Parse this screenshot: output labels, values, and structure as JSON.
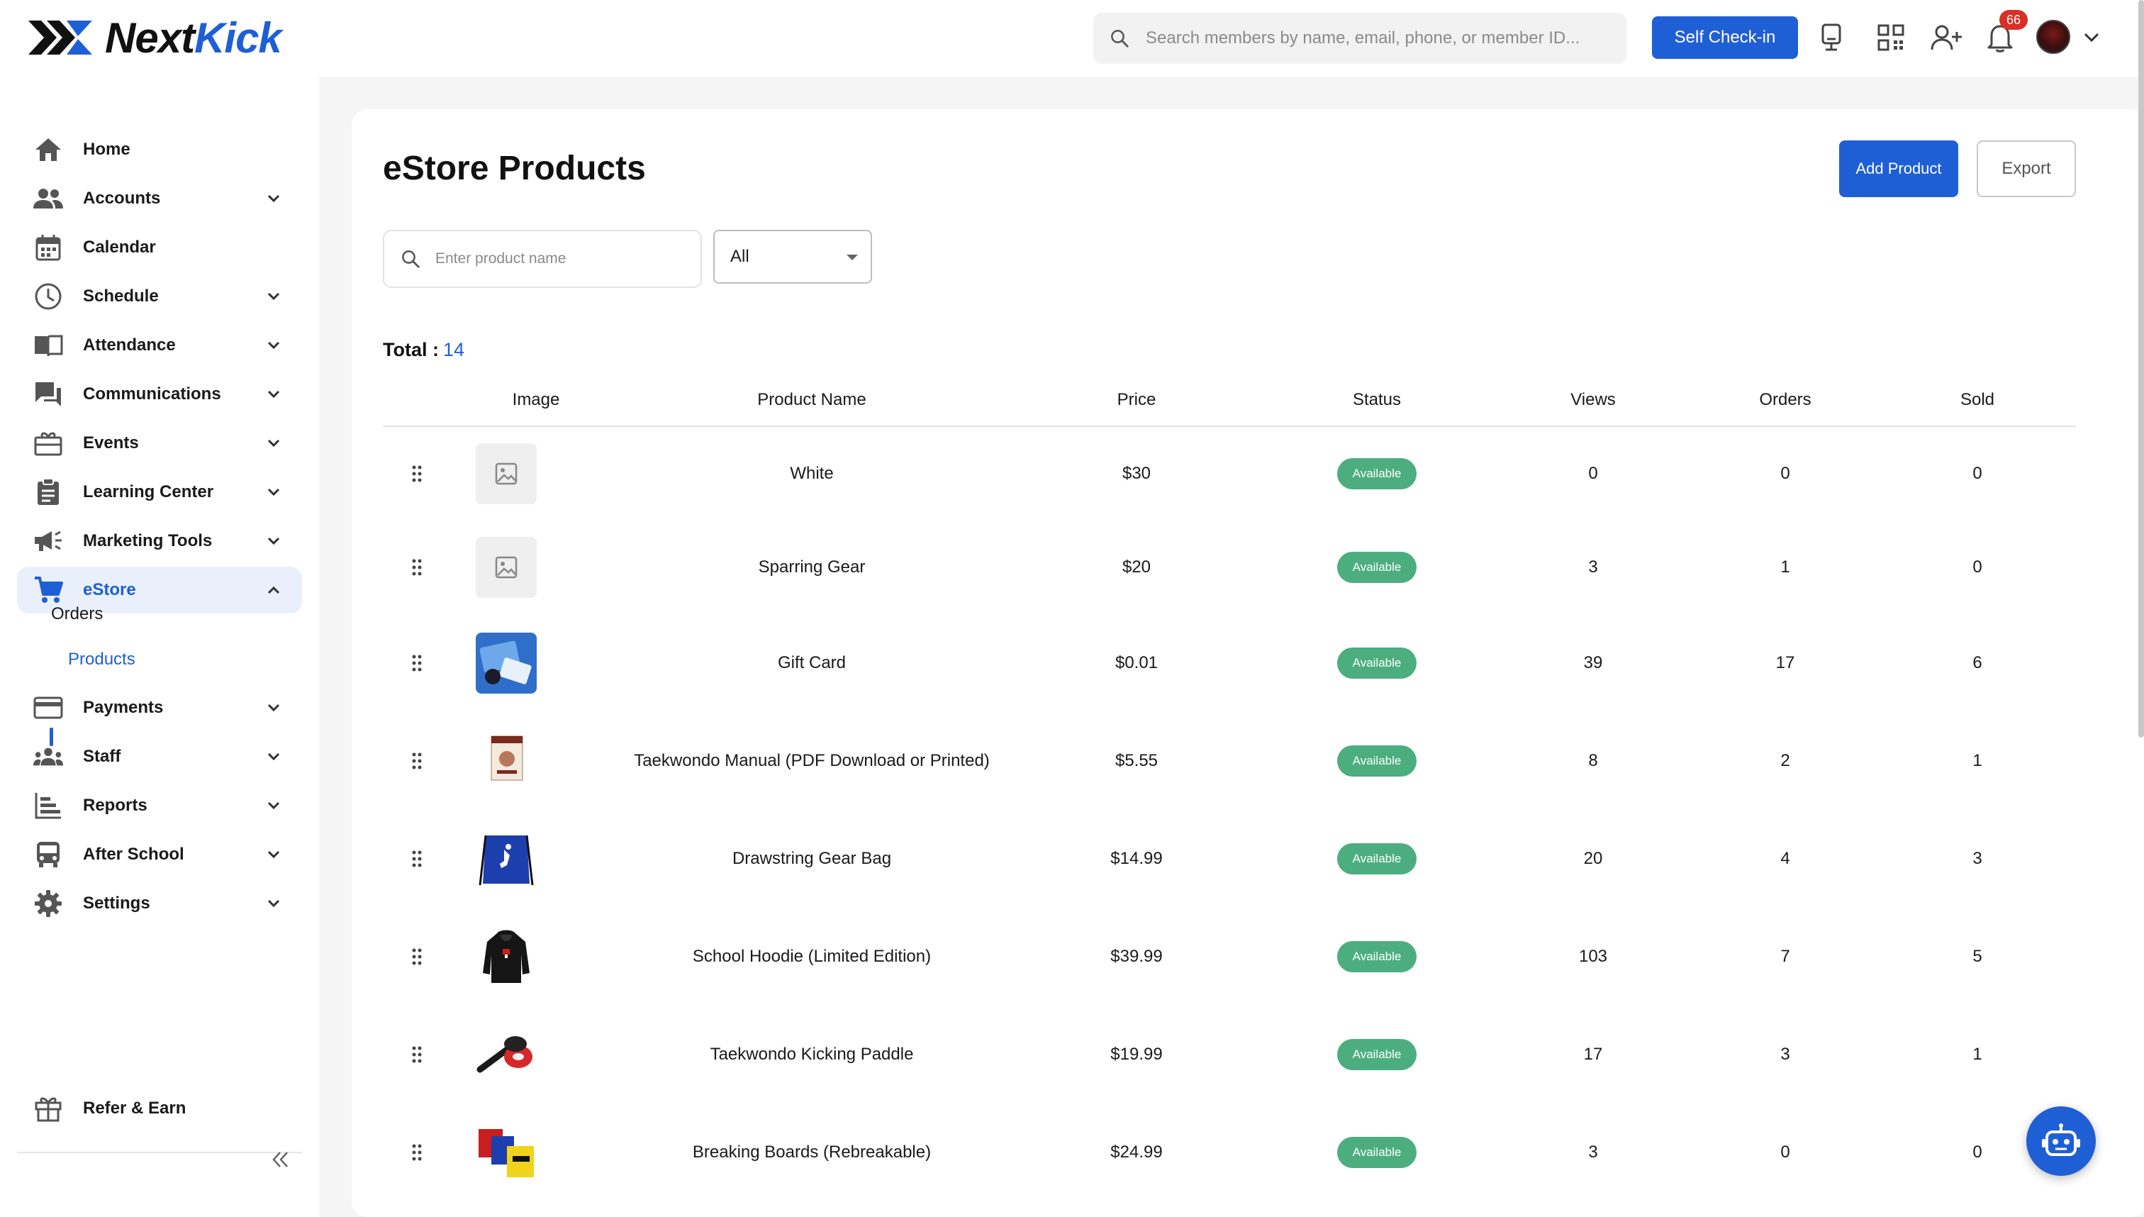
{
  "brand": {
    "name_part1": "Next",
    "name_part2": "Kick",
    "accent": "#1f5fd6"
  },
  "header": {
    "search_placeholder": "Search members by name, email, phone, or member ID...",
    "checkin_label": "Self Check-in",
    "notification_count": "66",
    "icons": [
      "kiosk-icon",
      "qr-code-icon",
      "add-person-icon",
      "bell-icon",
      "avatar",
      "chevron-down-icon"
    ]
  },
  "sidebar": {
    "items": [
      {
        "label": "Home",
        "icon": "home-icon"
      },
      {
        "label": "Accounts",
        "icon": "people-icon"
      },
      {
        "label": "Calendar",
        "icon": "calendar-icon"
      },
      {
        "label": "Schedule",
        "icon": "clock-icon"
      },
      {
        "label": "Attendance",
        "icon": "book-icon"
      },
      {
        "label": "Communications",
        "icon": "chat-icon"
      },
      {
        "label": "Events",
        "icon": "ticket-icon"
      },
      {
        "label": "Learning Center",
        "icon": "clipboard-icon"
      },
      {
        "label": "Marketing Tools",
        "icon": "megaphone-icon"
      },
      {
        "label": "eStore",
        "icon": "cart-icon"
      },
      {
        "label": "Payments",
        "icon": "card-icon"
      },
      {
        "label": "Staff",
        "icon": "group-icon"
      },
      {
        "label": "Reports",
        "icon": "chart-icon"
      },
      {
        "label": "After School",
        "icon": "bus-icon"
      },
      {
        "label": "Settings",
        "icon": "gear-icon"
      }
    ],
    "estore_sub": {
      "orders": "Orders",
      "products": "Products"
    },
    "refer_label": "Refer & Earn"
  },
  "main": {
    "title": "eStore Products",
    "add_label": "Add Product",
    "export_label": "Export",
    "product_search_placeholder": "Enter product name",
    "filter_value": "All",
    "total_label": "Total :",
    "total_value": "14",
    "columns": [
      "Image",
      "Product Name",
      "Price",
      "Status",
      "Views",
      "Orders",
      "Sold"
    ],
    "status_color": "#4cae7f",
    "rows": [
      {
        "name": "White",
        "price": "$30",
        "status": "Available",
        "views": "0",
        "orders": "0",
        "sold": "0",
        "image": "placeholder"
      },
      {
        "name": "Sparring Gear",
        "price": "$20",
        "status": "Available",
        "views": "3",
        "orders": "1",
        "sold": "0",
        "image": "placeholder"
      },
      {
        "name": "Gift Card",
        "price": "$0.01",
        "status": "Available",
        "views": "39",
        "orders": "17",
        "sold": "6",
        "image": "gift-card"
      },
      {
        "name": "Taekwondo Manual (PDF Download or Printed)",
        "price": "$5.55",
        "status": "Available",
        "views": "8",
        "orders": "2",
        "sold": "1",
        "image": "book"
      },
      {
        "name": "Drawstring Gear Bag",
        "price": "$14.99",
        "status": "Available",
        "views": "20",
        "orders": "4",
        "sold": "3",
        "image": "bag"
      },
      {
        "name": "School Hoodie (Limited Edition)",
        "price": "$39.99",
        "status": "Available",
        "views": "103",
        "orders": "7",
        "sold": "5",
        "image": "hoodie"
      },
      {
        "name": "Taekwondo Kicking Paddle",
        "price": "$19.99",
        "status": "Available",
        "views": "17",
        "orders": "3",
        "sold": "1",
        "image": "paddle"
      },
      {
        "name": "Breaking Boards (Rebreakable)",
        "price": "$24.99",
        "status": "Available",
        "views": "3",
        "orders": "0",
        "sold": "0",
        "image": "boards"
      }
    ]
  }
}
